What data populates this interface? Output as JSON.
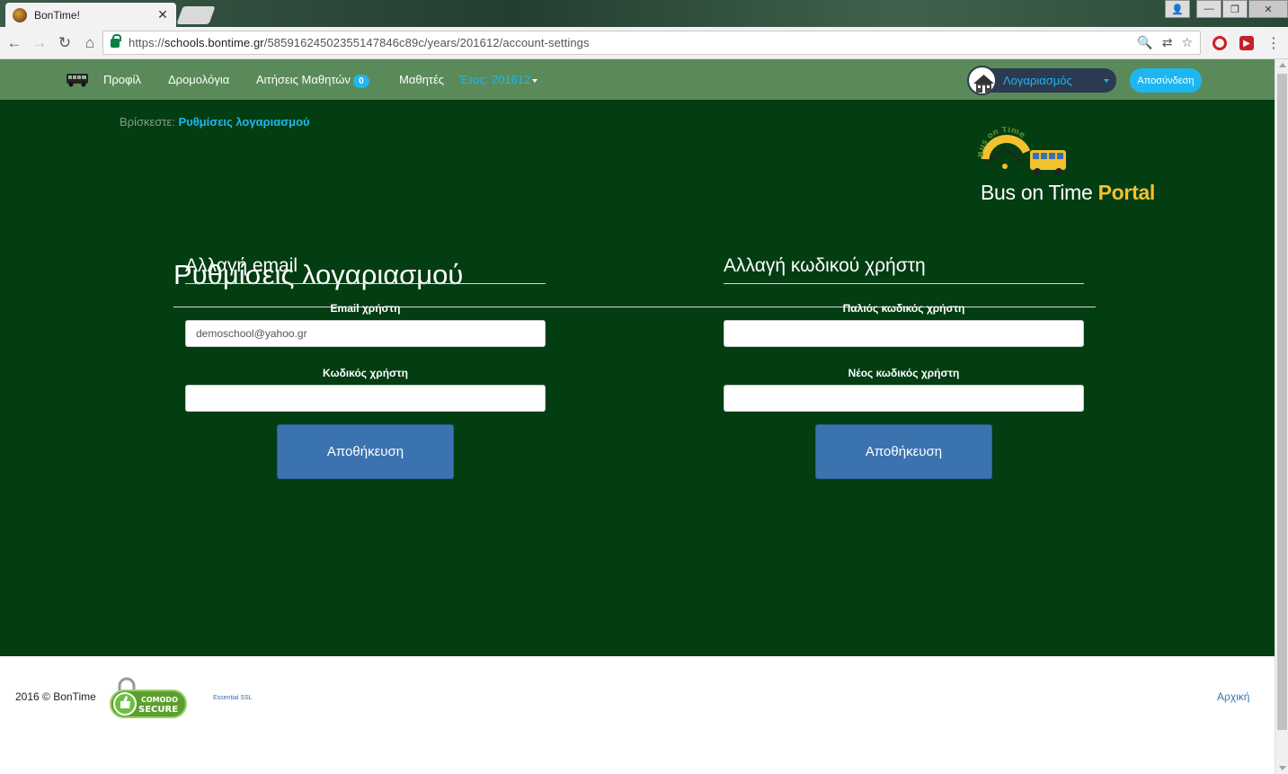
{
  "browser": {
    "tab_title": "BonTime!",
    "url_scheme": "https://",
    "url_host": "schools.bontime.gr",
    "url_path": "/58591624502355147846c89c/years/201612/account-settings"
  },
  "nav": {
    "profile": "Προφίλ",
    "routes": "Δρομολόγια",
    "requests": "Αιτήσεις Μαθητών",
    "requests_count": "0",
    "students": "Μαθητές",
    "year": "Έτος: 201612",
    "account": "Λογαριασμός",
    "logout": "Αποσύνδεση"
  },
  "breadcrumb": {
    "prefix": "Βρίσκεστε:",
    "current": "Ρυθμίσεις λογαριασμού"
  },
  "brand": {
    "name": "Bus on Time",
    "portal": "Portal",
    "logo_arc": "Bus on Time"
  },
  "page": {
    "title": "Ρυθμίσεις λογαριασμού"
  },
  "email_form": {
    "title": "Αλλαγή email",
    "email_label": "Email χρήστη",
    "email_value": "demoschool@yahoo.gr",
    "password_label": "Κωδικός χρήστη",
    "save": "Αποθήκευση"
  },
  "password_form": {
    "title": "Αλλαγή κωδικού χρήστη",
    "old_label": "Παλιός κωδικός χρήστη",
    "new_label": "Νέος κωδικός χρήστη",
    "save": "Αποθήκευση"
  },
  "footer": {
    "copyright": "2016 © BonTime",
    "comodo_top": "COMODO",
    "comodo_bottom": "SECURE",
    "ssl": "Essential SSL",
    "home": "Αρχική"
  },
  "colors": {
    "nav_bg": "#5a8a5a",
    "main_bg": "#033d12",
    "accent": "#1eb6f0",
    "button": "#3a73b0",
    "brand_portal": "#f2c12e"
  }
}
